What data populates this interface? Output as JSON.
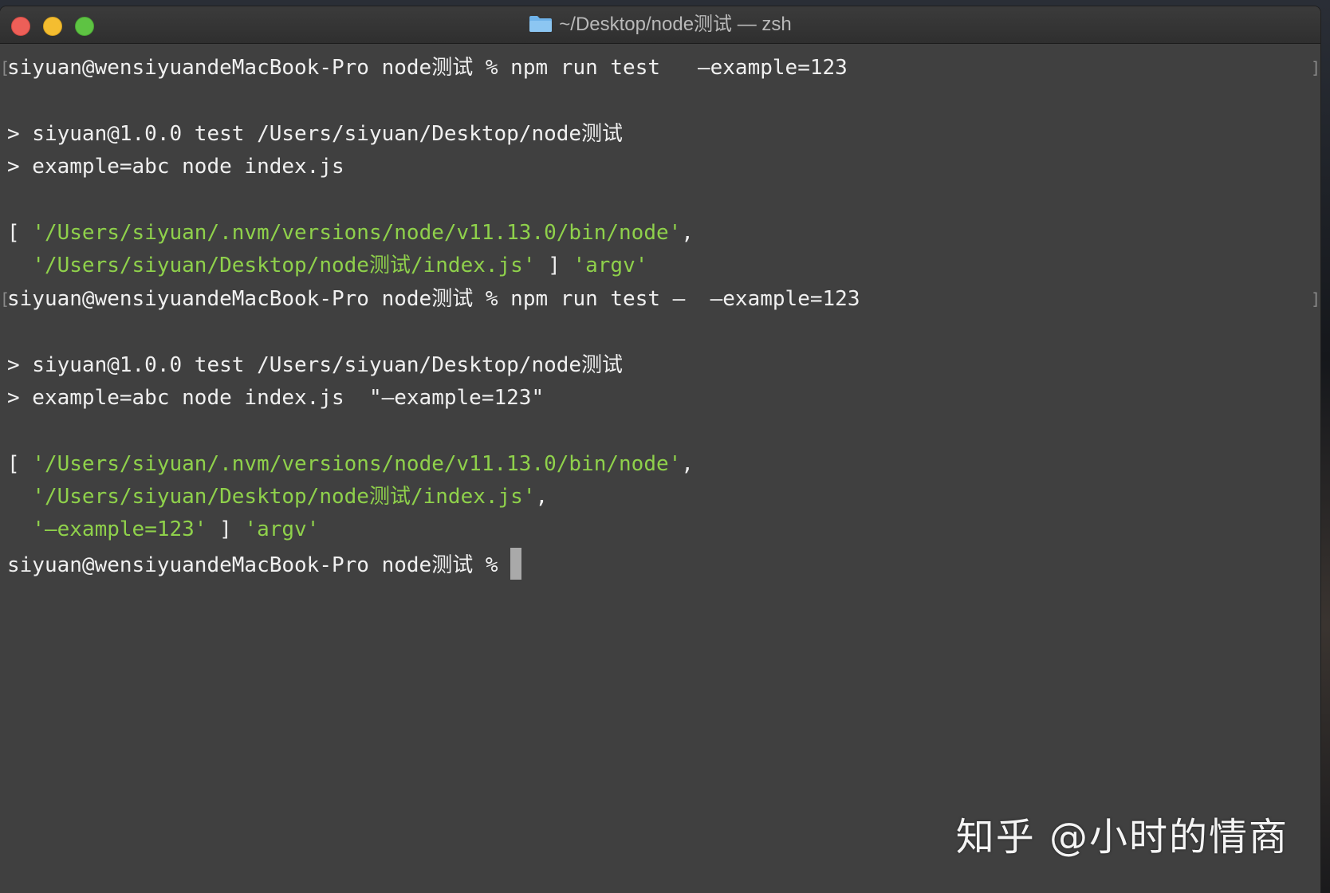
{
  "window": {
    "title": "~/Desktop/node测试 — zsh",
    "title_icon": "folder-icon",
    "buttons": {
      "close_color": "#ed5f58",
      "minimize_color": "#f4bd30",
      "maximize_color": "#5ec343"
    }
  },
  "terminal": {
    "background": "#404040",
    "string_color": "#8fd14b",
    "lines": [
      {
        "text": "siyuan@wensiyuandeMacBook-Pro node测试 % npm run test   —example=123",
        "marked": true
      },
      {
        "text": "> siyuan@1.0.0 test /Users/siyuan/Desktop/node测试"
      },
      {
        "text": "> example=abc node index.js"
      },
      {
        "prefix": "[ ",
        "s1": "'/Users/siyuan/.nvm/versions/node/v11.13.0/bin/node'",
        "suffix": ","
      },
      {
        "prefix": "  ",
        "s1": "'/Users/siyuan/Desktop/node测试/index.js'",
        "mid": " ] ",
        "s2": "'argv'"
      },
      {
        "text": "siyuan@wensiyuandeMacBook-Pro node测试 % npm run test —  —example=123",
        "marked": true
      },
      {
        "text": "> siyuan@1.0.0 test /Users/siyuan/Desktop/node测试"
      },
      {
        "text": "> example=abc node index.js  \"—example=123\""
      },
      {
        "prefix": "[ ",
        "s1": "'/Users/siyuan/.nvm/versions/node/v11.13.0/bin/node'",
        "suffix": ","
      },
      {
        "prefix": "  ",
        "s1": "'/Users/siyuan/Desktop/node测试/index.js'",
        "suffix": ","
      },
      {
        "prefix": "  ",
        "s1": "'—example=123'",
        "mid": " ] ",
        "s2": "'argv'"
      },
      {
        "text": "siyuan@wensiyuandeMacBook-Pro node测试 % "
      }
    ]
  },
  "watermark": {
    "text": "知乎 @小时的情商"
  }
}
